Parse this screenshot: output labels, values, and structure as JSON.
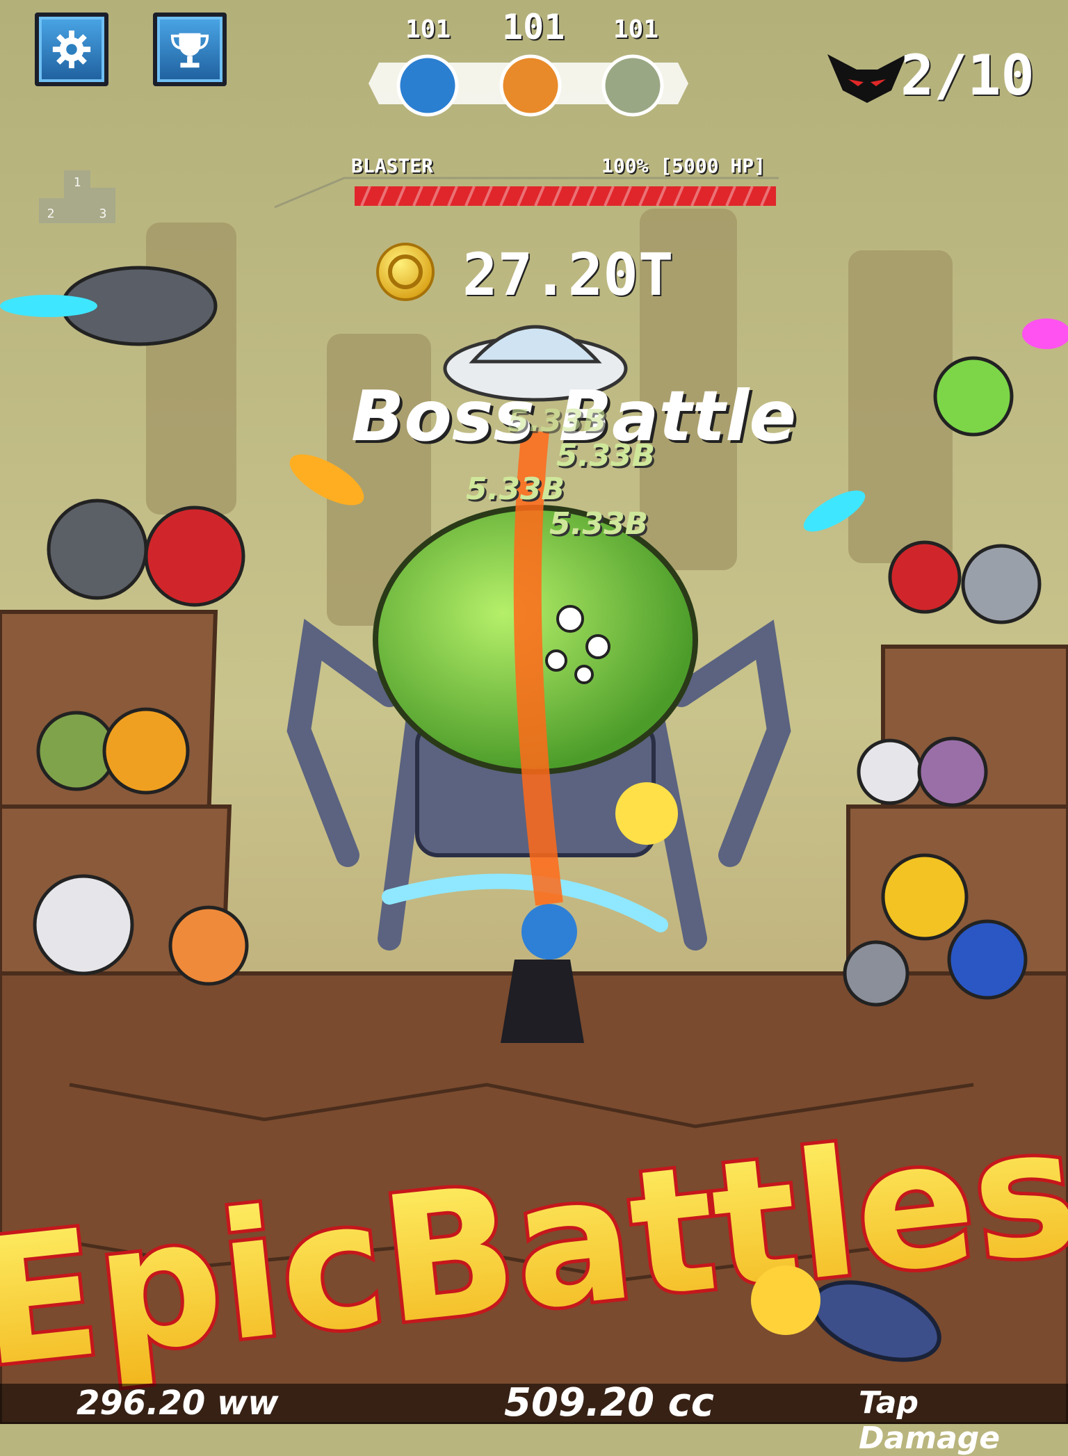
{
  "hud": {
    "settings_icon": "gear-icon",
    "trophy_icon": "trophy-icon",
    "stages": [
      {
        "level": "101",
        "planet": "blue-ocean"
      },
      {
        "level": "101",
        "planet": "orange-desert"
      },
      {
        "level": "101",
        "planet": "green-ruins"
      }
    ],
    "boss_counter": "2/10",
    "boss_icon": "devil-mask-icon",
    "podium_icon": "podium-icon",
    "podium_ranks": [
      "1",
      "2",
      "3"
    ]
  },
  "boss": {
    "name": "BLASTER",
    "hp_text": "100% [5000 HP]",
    "hp_fraction": 1.0
  },
  "currency": {
    "coin_icon": "coin-icon",
    "amount": "27.20T"
  },
  "battle": {
    "banner": "Boss Battle",
    "damage_numbers": [
      "5.33B",
      "5.33B",
      "5.33B",
      "5.33B"
    ]
  },
  "logo": {
    "text": "EpicBattles"
  },
  "footer": {
    "left": "296.20 ww",
    "center": "509.20 cc",
    "right": "Tap Damage"
  },
  "colors": {
    "sky": "#b9b57e",
    "rock": "#8a5a3a",
    "hp_bar": "#e0262b",
    "logo_fill": "#ffe33a",
    "logo_outline": "#c5171c"
  }
}
